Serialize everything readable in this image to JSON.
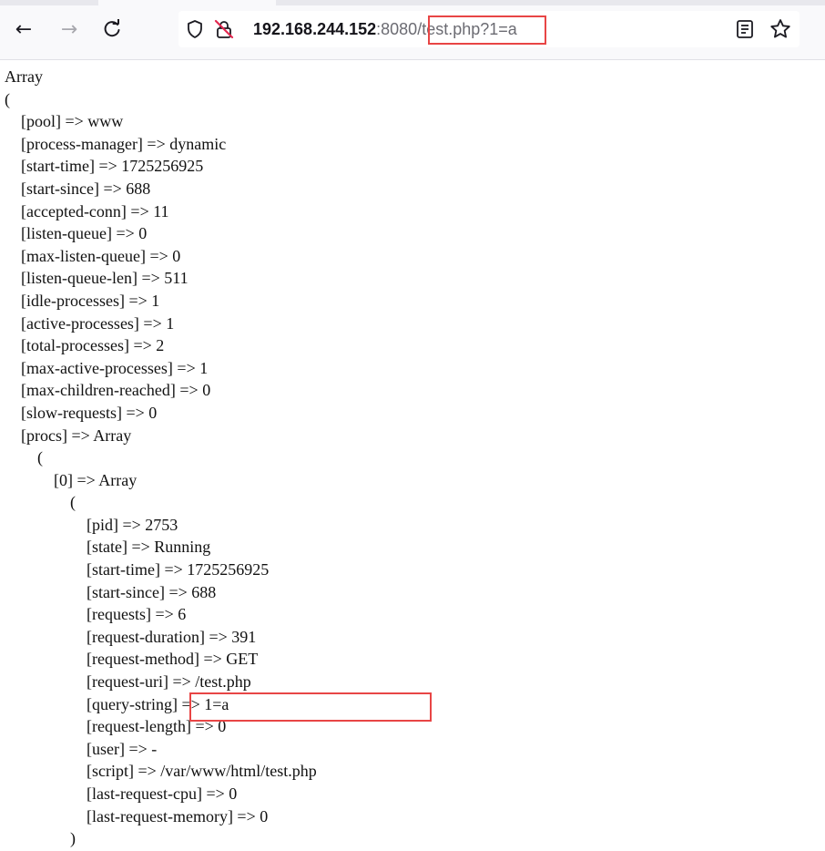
{
  "browser": {
    "nav": {
      "back_icon": "←",
      "forward_icon": "→",
      "reload_icon": "↻"
    },
    "url": {
      "host": "192.168.244.152",
      "port": ":8080",
      "separator": "/",
      "path": "test.php?1=a"
    },
    "icons": {
      "shield": "shield-icon",
      "lock": "insecure-lock-icon",
      "reader": "reader-view-icon",
      "bookmark": "bookmark-star-icon"
    },
    "highlight_color": "#e84545"
  },
  "dump": {
    "lines": [
      "Array",
      "(",
      "    [pool] => www",
      "    [process-manager] => dynamic",
      "    [start-time] => 1725256925",
      "    [start-since] => 688",
      "    [accepted-conn] => 11",
      "    [listen-queue] => 0",
      "    [max-listen-queue] => 0",
      "    [listen-queue-len] => 511",
      "    [idle-processes] => 1",
      "    [active-processes] => 1",
      "    [total-processes] => 2",
      "    [max-active-processes] => 1",
      "    [max-children-reached] => 0",
      "    [slow-requests] => 0",
      "    [procs] => Array",
      "        (",
      "            [0] => Array",
      "                (",
      "                    [pid] => 2753",
      "                    [state] => Running",
      "                    [start-time] => 1725256925",
      "                    [start-since] => 688",
      "                    [requests] => 6",
      "                    [request-duration] => 391",
      "                    [request-method] => GET",
      "                    [request-uri] => /test.php",
      "                    [query-string] => 1=a",
      "                    [request-length] => 0",
      "                    [user] => -",
      "                    [script] => /var/www/html/test.php",
      "                    [last-request-cpu] => 0",
      "                    [last-request-memory] => 0",
      "                )"
    ]
  }
}
